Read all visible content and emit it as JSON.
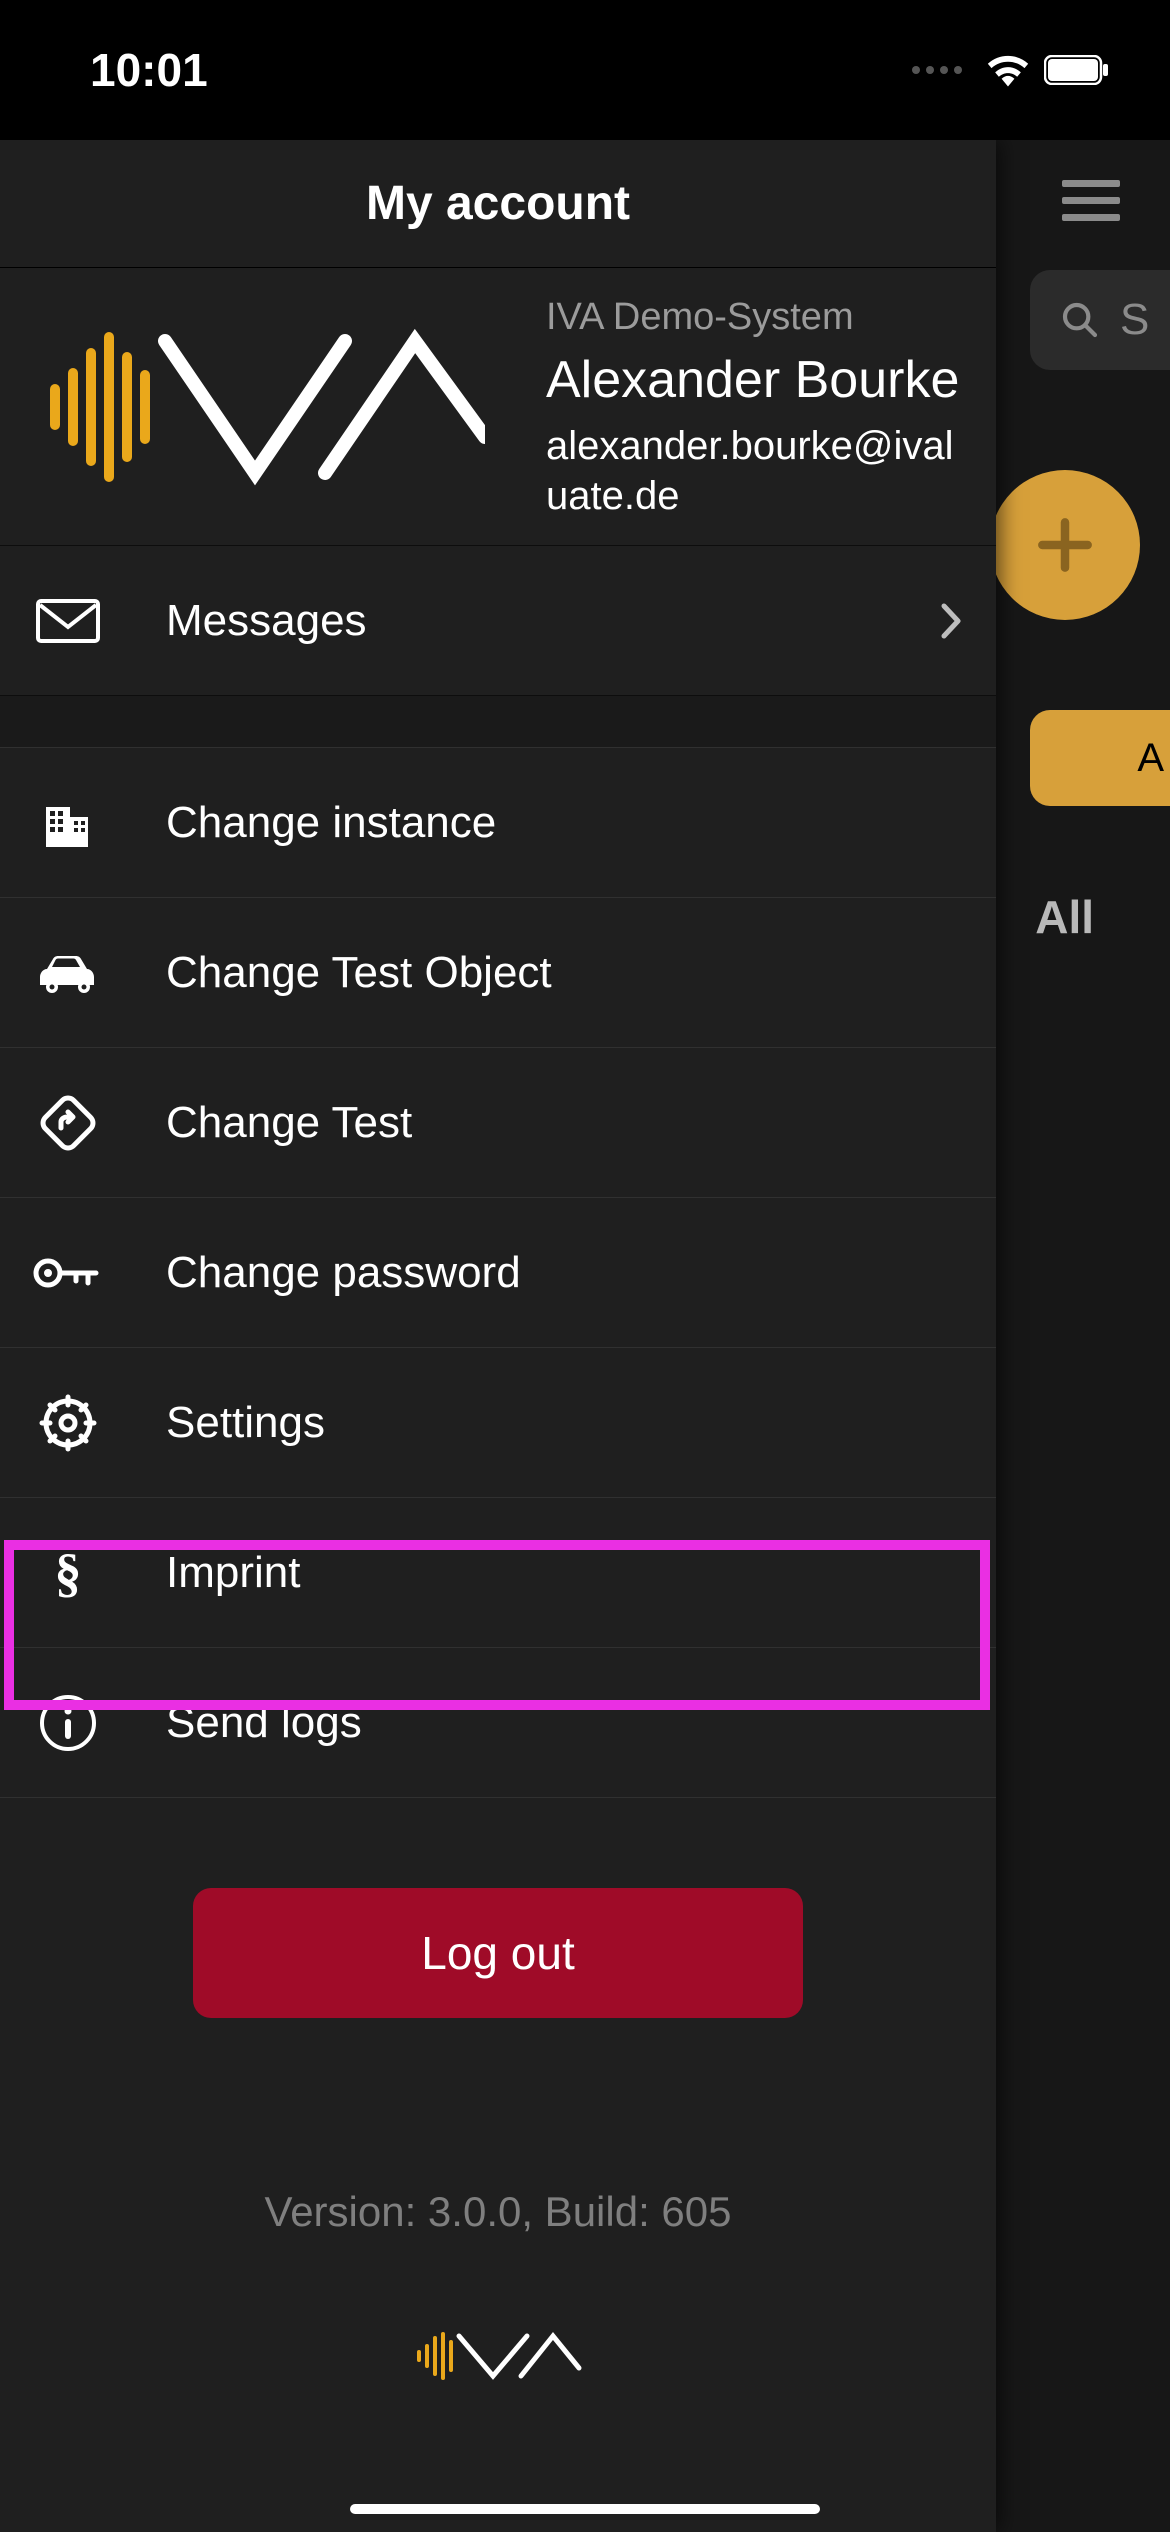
{
  "status": {
    "time": "10:01"
  },
  "drawer": {
    "title": "My account",
    "system_label": "IVA Demo-System",
    "user_name": "Alexander Bourke",
    "user_email": "alexander.bourke@ivaluate.de",
    "messages_label": "Messages",
    "items": [
      {
        "label": "Change instance"
      },
      {
        "label": "Change Test Object"
      },
      {
        "label": "Change Test"
      },
      {
        "label": "Change password"
      },
      {
        "label": "Settings"
      },
      {
        "label": "Imprint"
      },
      {
        "label": "Send logs"
      }
    ],
    "logout_label": "Log out",
    "version_label": "Version: 3.0.0, Build: 605"
  },
  "background": {
    "search_placeholder": "S",
    "pill_label": "A",
    "section_label": "All"
  },
  "highlight": {
    "target": "settings"
  },
  "colors": {
    "accent": "#d7a03a",
    "danger": "#9f0b28",
    "highlight": "#ea2fe3"
  }
}
